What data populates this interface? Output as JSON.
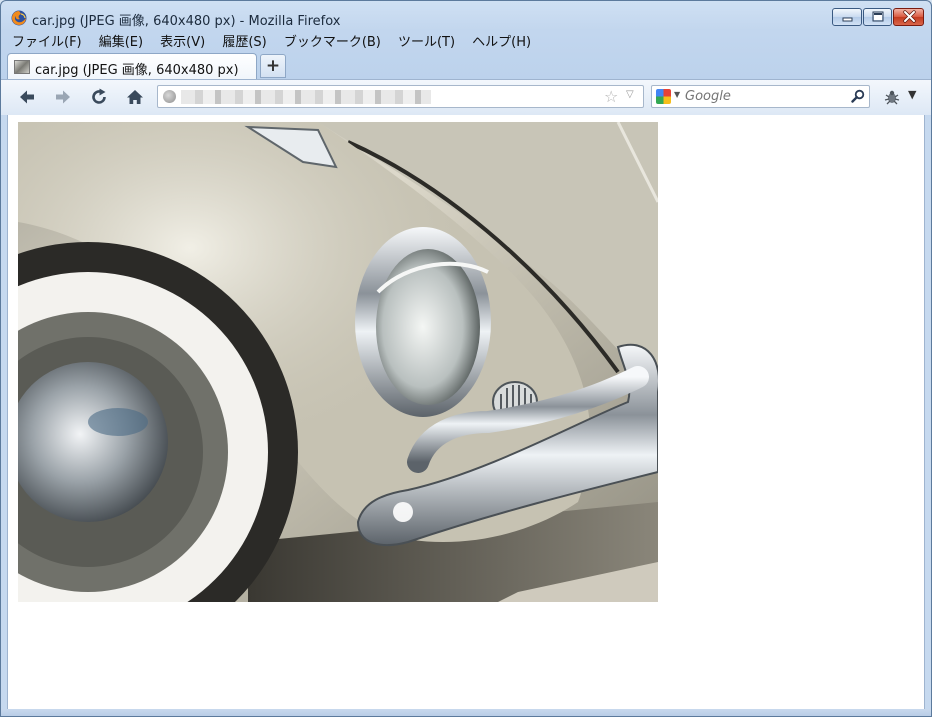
{
  "window": {
    "title": "car.jpg (JPEG 画像, 640x480 px) - Mozilla Firefox",
    "app_icon": "firefox-icon",
    "controls": [
      "minimize",
      "maximize",
      "close"
    ]
  },
  "menu": {
    "items": [
      "ファイル(F)",
      "編集(E)",
      "表示(V)",
      "履歴(S)",
      "ブックマーク(B)",
      "ツール(T)",
      "ヘルプ(H)"
    ]
  },
  "tabs": [
    {
      "label": "car.jpg (JPEG 画像, 640x480 px)",
      "active": true,
      "icon": "image-thumbnail"
    }
  ],
  "newtab_label": "+",
  "toolbar": {
    "buttons": [
      "back-icon",
      "forward-icon",
      "reload-icon",
      "home-icon"
    ],
    "url": {
      "value": "",
      "blurred": true,
      "bookmark_icon": "star-icon",
      "dropdown_icon": "triangle-down"
    },
    "search": {
      "placeholder": "Google",
      "engine_icon": "google-icon",
      "go_icon": "search-icon"
    },
    "star_glyph": "☆",
    "dropdown_glyph": "▽",
    "search_dd_glyph": "▼",
    "menu_dd_glyph": "▼"
  },
  "content": {
    "image_alt": "car.jpg",
    "image_description_colors": {
      "body": "#c9c6b7",
      "chrome": "#e8eef2",
      "shadow": "#5a5a52"
    }
  },
  "colors": {
    "titlebar": "#c2d6ee",
    "close_button": "#c33a1f",
    "content_bg": "#ffffff"
  }
}
